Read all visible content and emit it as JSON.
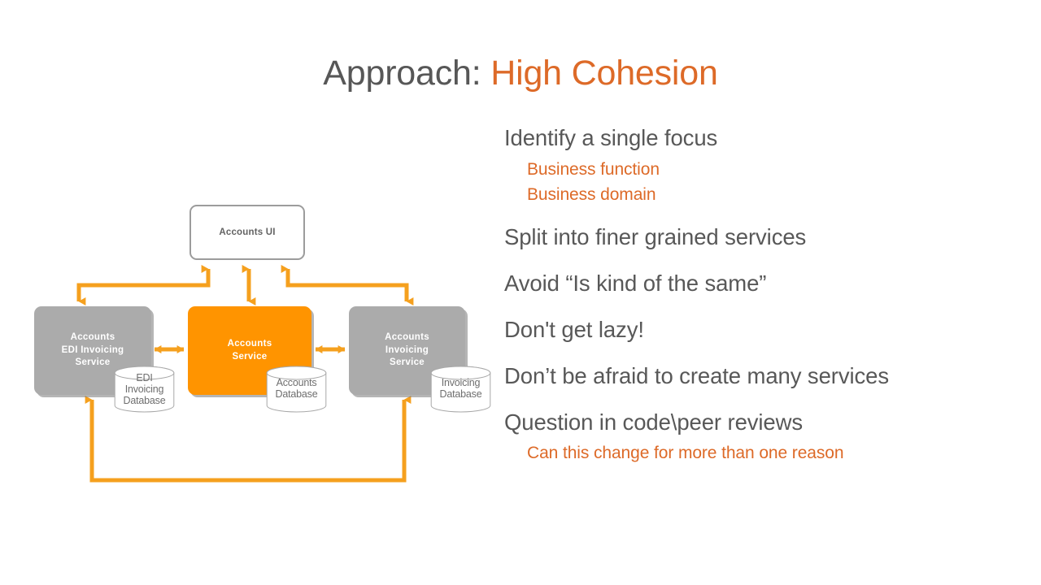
{
  "title": {
    "main": "Approach: ",
    "accent": "High Cohesion"
  },
  "colors": {
    "accent_orange": "#DD6A28",
    "body_gray": "#585858",
    "box_orange": "#FF9400",
    "box_gray": "#ABABAB",
    "connector_orange": "#F5A01E"
  },
  "bullets": [
    {
      "text": "Identify a single focus",
      "level": 1
    },
    {
      "text": "Business function",
      "level": 2
    },
    {
      "text": "Business domain",
      "level": 2
    },
    {
      "text": "Split into finer grained services",
      "level": 1
    },
    {
      "text": "Avoid “Is kind of the same”",
      "level": 1
    },
    {
      "text": "Don't get lazy!",
      "level": 1
    },
    {
      "text": "Don’t be afraid to create many services",
      "level": 1
    },
    {
      "text": "Question in code\\peer reviews",
      "level": 1
    },
    {
      "text": "Can this change for more than one reason",
      "level": 2
    }
  ],
  "diagram": {
    "ui_node": {
      "label": "Accounts UI"
    },
    "services": [
      {
        "id": "edi",
        "label": "Accounts\nEDI Invoicing\nService",
        "fill": "#ABABAB"
      },
      {
        "id": "accounts",
        "label": "Accounts\nService",
        "fill": "#FF9400"
      },
      {
        "id": "invoicing",
        "label": "Accounts\nInvoicing\nService",
        "fill": "#ABABAB"
      }
    ],
    "databases": [
      {
        "id": "edi-db",
        "label": "EDI\nInvoicing\nDatabase"
      },
      {
        "id": "accounts-db",
        "label": "Accounts\nDatabase"
      },
      {
        "id": "invoicing-db",
        "label": "Invoicing\nDatabase"
      }
    ],
    "connectors": [
      {
        "from": "accounts-ui",
        "to": "edi-service",
        "style": "elbow-double-arrow"
      },
      {
        "from": "accounts-ui",
        "to": "accounts-service",
        "style": "vertical-double-arrow"
      },
      {
        "from": "accounts-ui",
        "to": "invoicing-service",
        "style": "elbow-double-arrow"
      },
      {
        "from": "edi-service",
        "to": "accounts-service",
        "style": "horizontal-double-arrow"
      },
      {
        "from": "accounts-service",
        "to": "invoicing-service",
        "style": "horizontal-double-arrow"
      },
      {
        "from": "edi-service",
        "to": "invoicing-service",
        "style": "u-shaped-double-arrow"
      }
    ]
  }
}
